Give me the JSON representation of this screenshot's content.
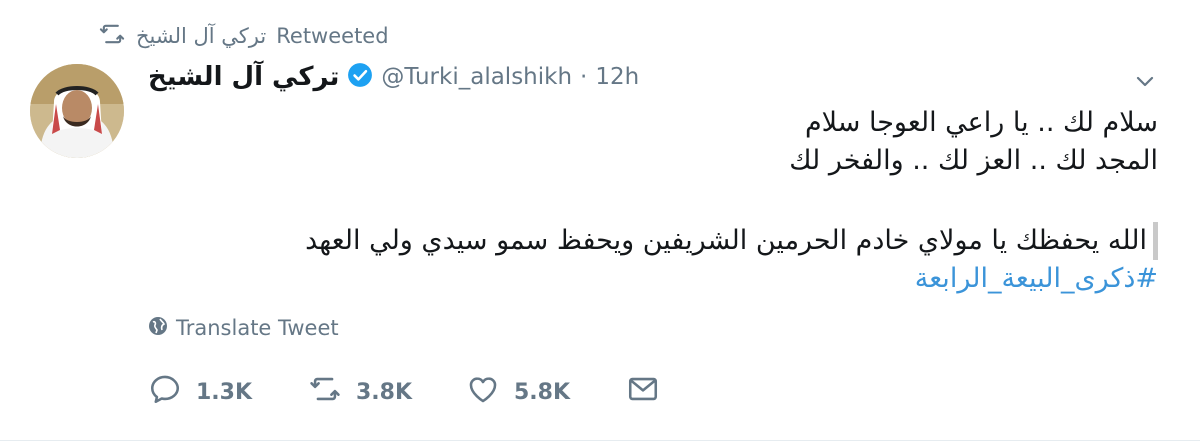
{
  "retweet_banner": {
    "retweeter": "تركي آل الشيخ",
    "label": "Retweeted"
  },
  "tweet": {
    "author_name": "تركي آل الشيخ",
    "handle": "@Turki_alalshikh",
    "separator": "·",
    "time": "12h",
    "lines": [
      "سلام لك .. يا راعي العوجا سلام",
      "المجد لك .. العز لك .. والفخر لك"
    ],
    "quoted_line": "الله يحفظك يا مولاي خادم الحرمين الشريفين ويحفظ سمو سيدي ولي العهد",
    "hashtag": "#ذكرى_البيعة_الرابعة"
  },
  "translate": {
    "label": "Translate Tweet"
  },
  "actions": {
    "replies": "1.3K",
    "retweets": "3.8K",
    "likes": "5.8K"
  },
  "icons": {
    "retweet": "retweet-icon",
    "verified": "verified-badge-icon",
    "caret": "chevron-down-icon",
    "globe": "globe-icon",
    "reply": "reply-icon",
    "like": "heart-icon",
    "dm": "envelope-icon"
  },
  "colors": {
    "muted": "#657786",
    "link": "#3b94d9",
    "verified": "#1da1f2",
    "text": "#14171a"
  }
}
